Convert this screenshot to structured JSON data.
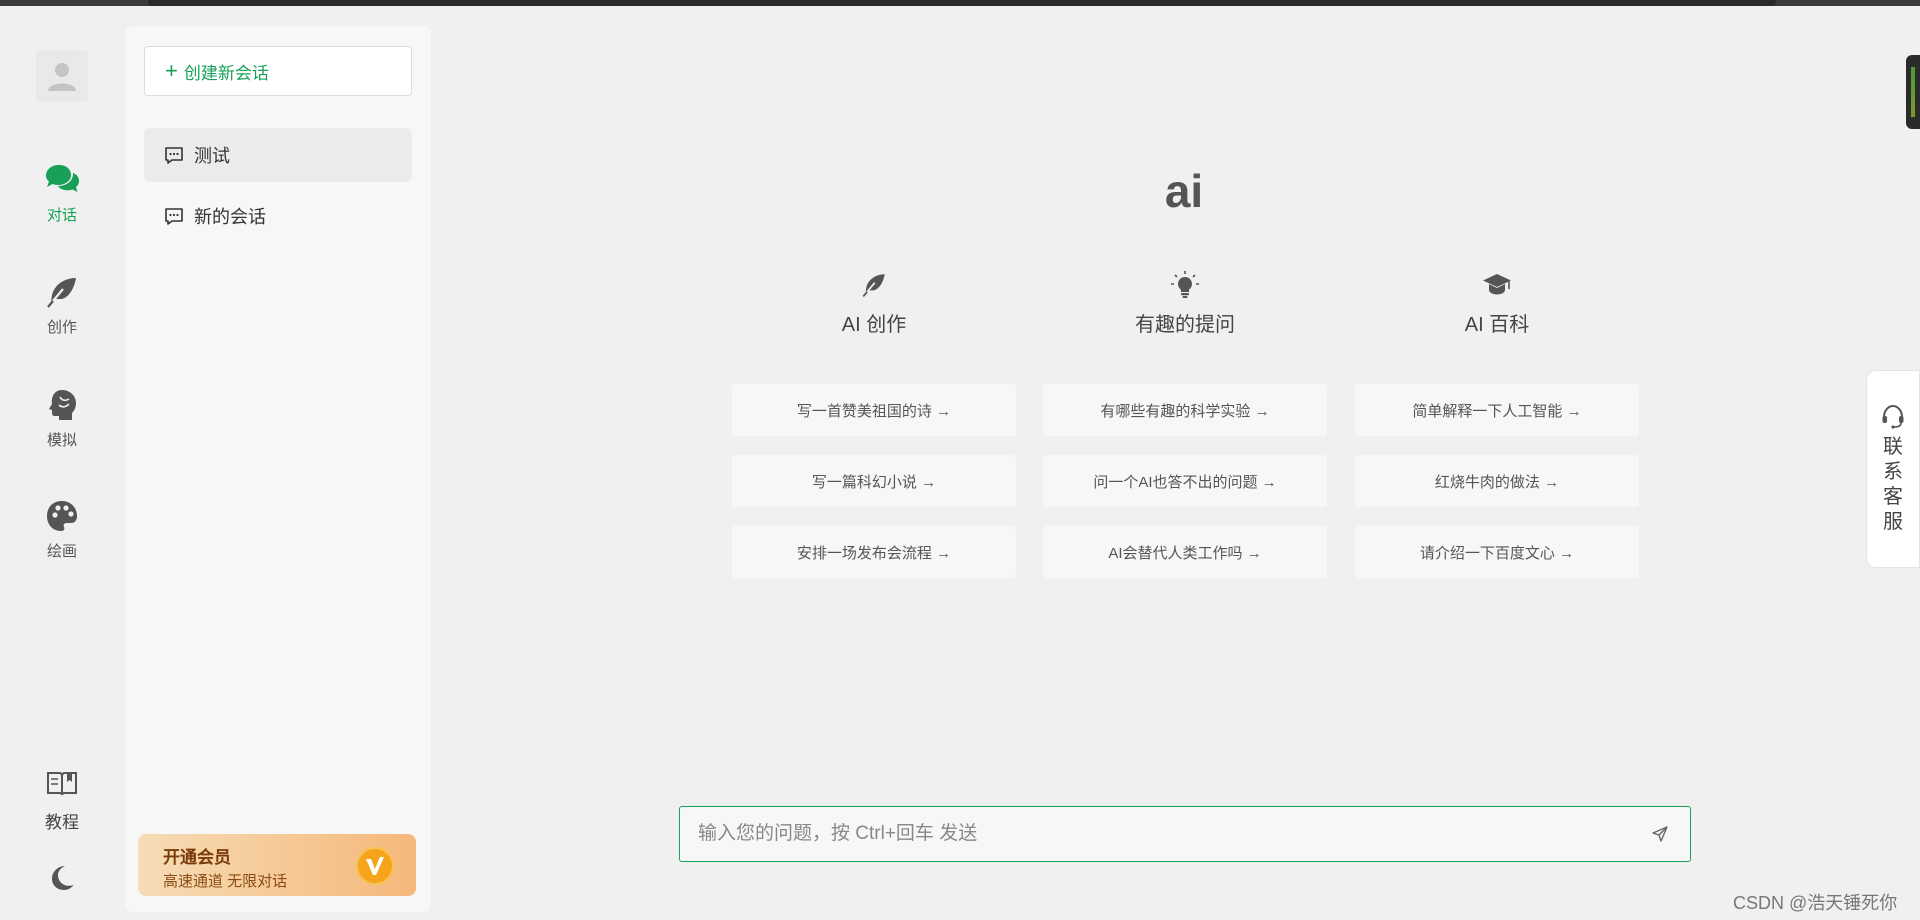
{
  "rail": {
    "items": [
      {
        "label": "对话",
        "icon": "chat-bubbles-icon",
        "active": true
      },
      {
        "label": "创作",
        "icon": "feather-icon",
        "active": false
      },
      {
        "label": "模拟",
        "icon": "head-profile-icon",
        "active": false
      },
      {
        "label": "绘画",
        "icon": "palette-icon",
        "active": false
      }
    ],
    "tutorial_label": "教程",
    "theme_icon": "moon-icon"
  },
  "sidebar": {
    "new_chat_label": "创建新会话",
    "conversations": [
      {
        "title": "测试",
        "active": true
      },
      {
        "title": "新的会话",
        "active": false
      }
    ],
    "vip": {
      "title": "开通会员",
      "subtitle": "高速通道 无限对话",
      "badge": "V"
    }
  },
  "main": {
    "brand": "ai",
    "columns": [
      {
        "title": "AI 创作",
        "icon": "feather-icon",
        "prompts": [
          "写一首赞美祖国的诗 →",
          "写一篇科幻小说 →",
          "安排一场发布会流程 →"
        ]
      },
      {
        "title": "有趣的提问",
        "icon": "lightbulb-icon",
        "prompts": [
          "有哪些有趣的科学实验 →",
          "问一个AI也答不出的问题 →",
          "AI会替代人类工作吗 →"
        ]
      },
      {
        "title": "AI 百科",
        "icon": "graduation-cap-icon",
        "prompts": [
          "简单解释一下人工智能 →",
          "红烧牛肉的做法 →",
          "请介绍一下百度文心 →"
        ]
      }
    ],
    "input": {
      "placeholder": "输入您的问题，按 Ctrl+回车 发送",
      "value": ""
    }
  },
  "support": {
    "chars": [
      "联",
      "系",
      "客",
      "服"
    ]
  },
  "watermark": "CSDN @浩天锤死你",
  "colors": {
    "accent": "#18a058",
    "vip_gradient_start": "#f6dcb6",
    "vip_gradient_end": "#f5b87a",
    "background": "#eff0ef"
  }
}
